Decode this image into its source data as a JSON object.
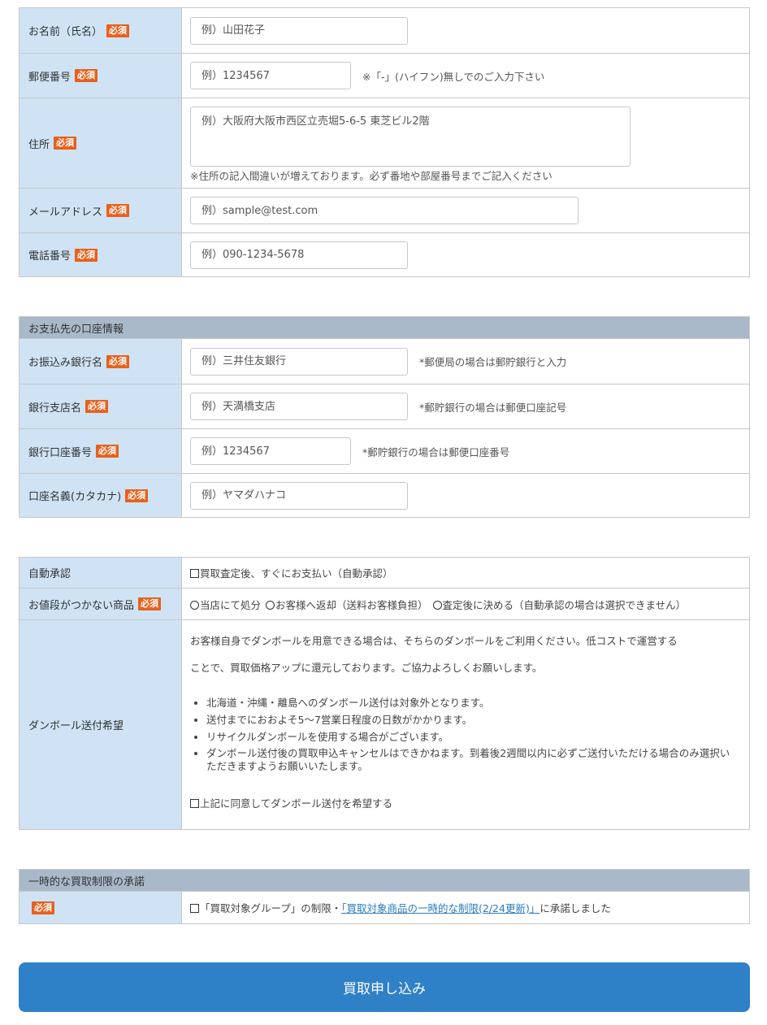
{
  "required_badge": "必須",
  "personal": {
    "name_label": "お名前（氏名）",
    "name_placeholder": "例）山田花子",
    "zip_label": "郵便番号",
    "zip_placeholder": "例）1234567",
    "zip_note": "※「-」(ハイフン)無しでのご入力下さい",
    "address_label": "住所",
    "address_placeholder": "例）大阪府大阪市西区立売堀5-6-5 東芝ビル2階",
    "address_note": "※住所の記入間違いが増えております。必ず番地や部屋番号までご記入ください",
    "email_label": "メールアドレス",
    "email_placeholder": "例）sample@test.com",
    "phone_label": "電話番号",
    "phone_placeholder": "例）090-1234-5678"
  },
  "bank": {
    "section_title": "お支払先の口座情報",
    "bank_name_label": "お振込み銀行名",
    "bank_name_placeholder": "例）三井住友銀行",
    "bank_name_note": "*郵便局の場合は郵貯銀行と入力",
    "branch_label": "銀行支店名",
    "branch_placeholder": "例）天満橋支店",
    "branch_note": "*郵貯銀行の場合は郵便口座記号",
    "account_label": "銀行口座番号",
    "account_placeholder": "例）1234567",
    "account_note": "*郵貯銀行の場合は郵便口座番号",
    "holder_label": "口座名義(カタカナ)",
    "holder_placeholder": "例）ヤマダハナコ"
  },
  "options": {
    "auto_label": "自動承認",
    "auto_checkbox": "買取査定後、すぐにお支払い（自動承認）",
    "noprice_label": "お値段がつかない商品",
    "noprice_options": [
      "当店にて処分",
      "お客様へ返却（送料お客様負担）",
      "査定後に決める（自動承認の場合は選択できません）"
    ],
    "box_label": "ダンボール送付希望",
    "box_intro": [
      "お客様自身でダンボールを用意できる場合は、そちらのダンボールをご利用ください。低コストで運営する",
      "ことで、買取価格アップに還元しております。ご協力よろしくお願いします。"
    ],
    "box_bullets": [
      "北海道・沖縄・離島へのダンボール送付は対象外となります。",
      "送付までにおおよそ5〜7営業日程度の日数がかかります。",
      "リサイクルダンボールを使用する場合がございます。",
      "ダンボール送付後の買取申込キャンセルはできかねます。到着後2週間以内に必ずご送付いただける場合のみ選択いただきますようお願いいたします。"
    ],
    "box_checkbox": "上記に同意してダンボール送付を希望する"
  },
  "limit": {
    "section_title": "一時的な買取制限の承諾",
    "text_before": "「買取対象グループ」の制限・",
    "link_text": "「買取対象商品の一時的な制限(2/24更新)」",
    "text_after": "に承諾しました"
  },
  "submit_label": "買取申し込み"
}
